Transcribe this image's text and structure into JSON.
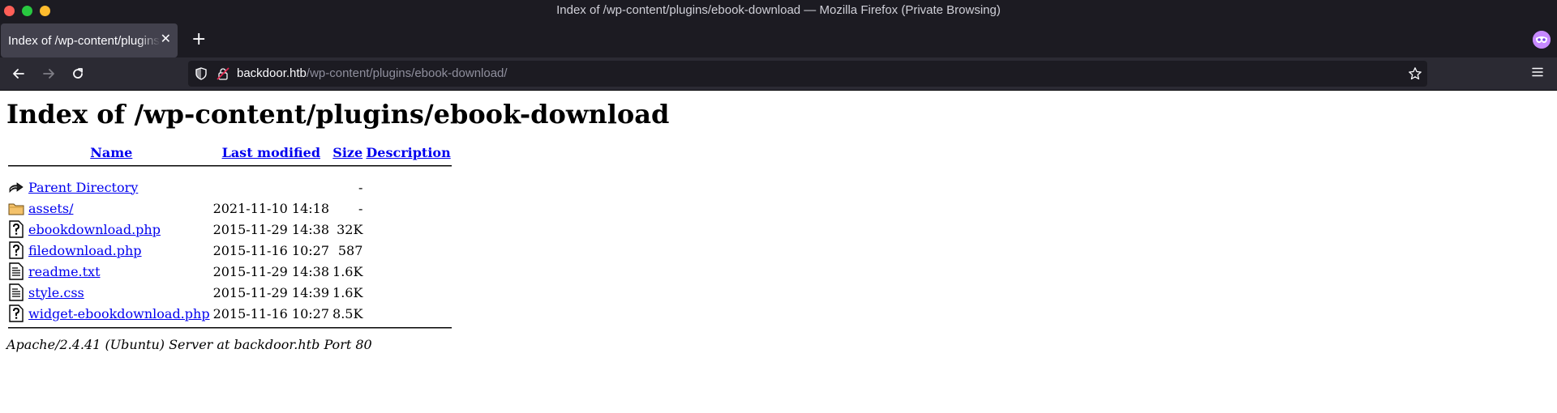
{
  "window": {
    "title": "Index of /wp-content/plugins/ebook-download — Mozilla Firefox (Private Browsing)",
    "controls": [
      {
        "name": "close",
        "color": "#ff5f57"
      },
      {
        "name": "maximize",
        "color": "#28c840"
      },
      {
        "name": "minimize",
        "color": "#febc2e"
      }
    ]
  },
  "tabs": {
    "active_label": "Index of /wp-content/plugins/ebook-download/",
    "close_glyph": "✕",
    "new_tab_glyph": "+"
  },
  "navbar": {
    "url_host": "backdoor.htb",
    "url_path": "/wp-content/plugins/ebook-download/"
  },
  "page": {
    "heading": "Index of /wp-content/plugins/ebook-download",
    "columns": {
      "name": "Name",
      "last_modified": "Last modified",
      "size": "Size",
      "description": "Description"
    },
    "rows": [
      {
        "icon": "back-icon",
        "name": "Parent Directory",
        "modified": "",
        "size": "-",
        "description": ""
      },
      {
        "icon": "folder-icon",
        "name": "assets/",
        "modified": "2021-11-10 14:18",
        "size": "-",
        "description": ""
      },
      {
        "icon": "unknown-file-icon",
        "name": "ebookdownload.php",
        "modified": "2015-11-29 14:38",
        "size": "32K",
        "description": ""
      },
      {
        "icon": "unknown-file-icon",
        "name": "filedownload.php",
        "modified": "2015-11-16 10:27",
        "size": "587",
        "description": ""
      },
      {
        "icon": "text-file-icon",
        "name": "readme.txt",
        "modified": "2015-11-29 14:38",
        "size": "1.6K",
        "description": ""
      },
      {
        "icon": "text-file-icon",
        "name": "style.css",
        "modified": "2015-11-29 14:39",
        "size": "1.6K",
        "description": ""
      },
      {
        "icon": "unknown-file-icon",
        "name": "widget-ebookdownload.php",
        "modified": "2015-11-16 10:27",
        "size": "8.5K",
        "description": ""
      }
    ],
    "signature": "Apache/2.4.41 (Ubuntu) Server at backdoor.htb Port 80"
  },
  "colors": {
    "link": "#0000ee",
    "chrome_dark": "#1c1b22",
    "chrome_mid": "#2b2a33",
    "tab_active": "#42414d",
    "private_accent": "#c689ff"
  }
}
